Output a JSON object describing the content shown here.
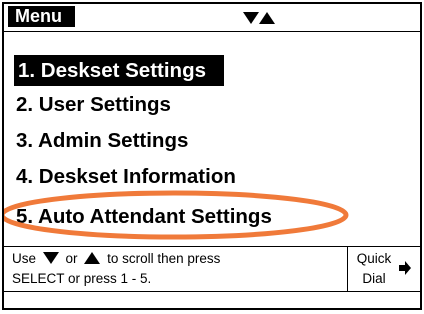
{
  "header": {
    "title": "Menu"
  },
  "menu": {
    "items": [
      {
        "label": "1. Deskset Settings",
        "selected": true
      },
      {
        "label": "2. User Settings",
        "selected": false
      },
      {
        "label": "3. Admin Settings",
        "selected": false
      },
      {
        "label": "4. Deskset Information",
        "selected": false
      },
      {
        "label": "5. Auto Attendant Settings",
        "selected": false
      }
    ]
  },
  "help": {
    "line1_prefix": "Use",
    "line1_or": "or",
    "line1_suffix": "to scroll then press",
    "line2": "SELECT or press 1 - 5."
  },
  "softkey": {
    "line1": "Quick",
    "line2": "Dial"
  },
  "colors": {
    "highlight_ellipse": "#f07a3a",
    "selected_bg": "#000000"
  },
  "icons": {
    "nav": [
      "down-triangle-icon",
      "up-triangle-icon"
    ],
    "help": [
      "down-triangle-icon",
      "up-triangle-icon"
    ],
    "softkey": "right-pointer-icon"
  }
}
